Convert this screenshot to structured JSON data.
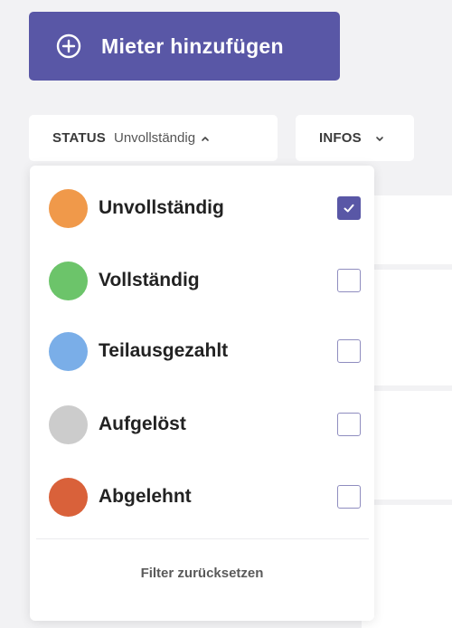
{
  "add_tenant_button": {
    "label": "Mieter hinzufügen",
    "icon": "plus-circle-icon",
    "color": "#5957a6"
  },
  "filters": {
    "status": {
      "key": "STATUS",
      "value": "Unvollständig",
      "icon": "chevron-up-icon"
    },
    "infos": {
      "key": "INFOS",
      "icon": "chevron-down-icon"
    }
  },
  "status_dropdown": {
    "options": [
      {
        "label": "Unvollständig",
        "color": "#f0994a",
        "checked": true
      },
      {
        "label": "Vollständig",
        "color": "#6cc46a",
        "checked": false
      },
      {
        "label": "Teilausgezahlt",
        "color": "#7aaee8",
        "checked": false
      },
      {
        "label": "Aufgelöst",
        "color": "#cccccc",
        "checked": false
      },
      {
        "label": "Abgelehnt",
        "color": "#d9613a",
        "checked": false
      }
    ],
    "reset_label": "Filter zurücksetzen"
  }
}
